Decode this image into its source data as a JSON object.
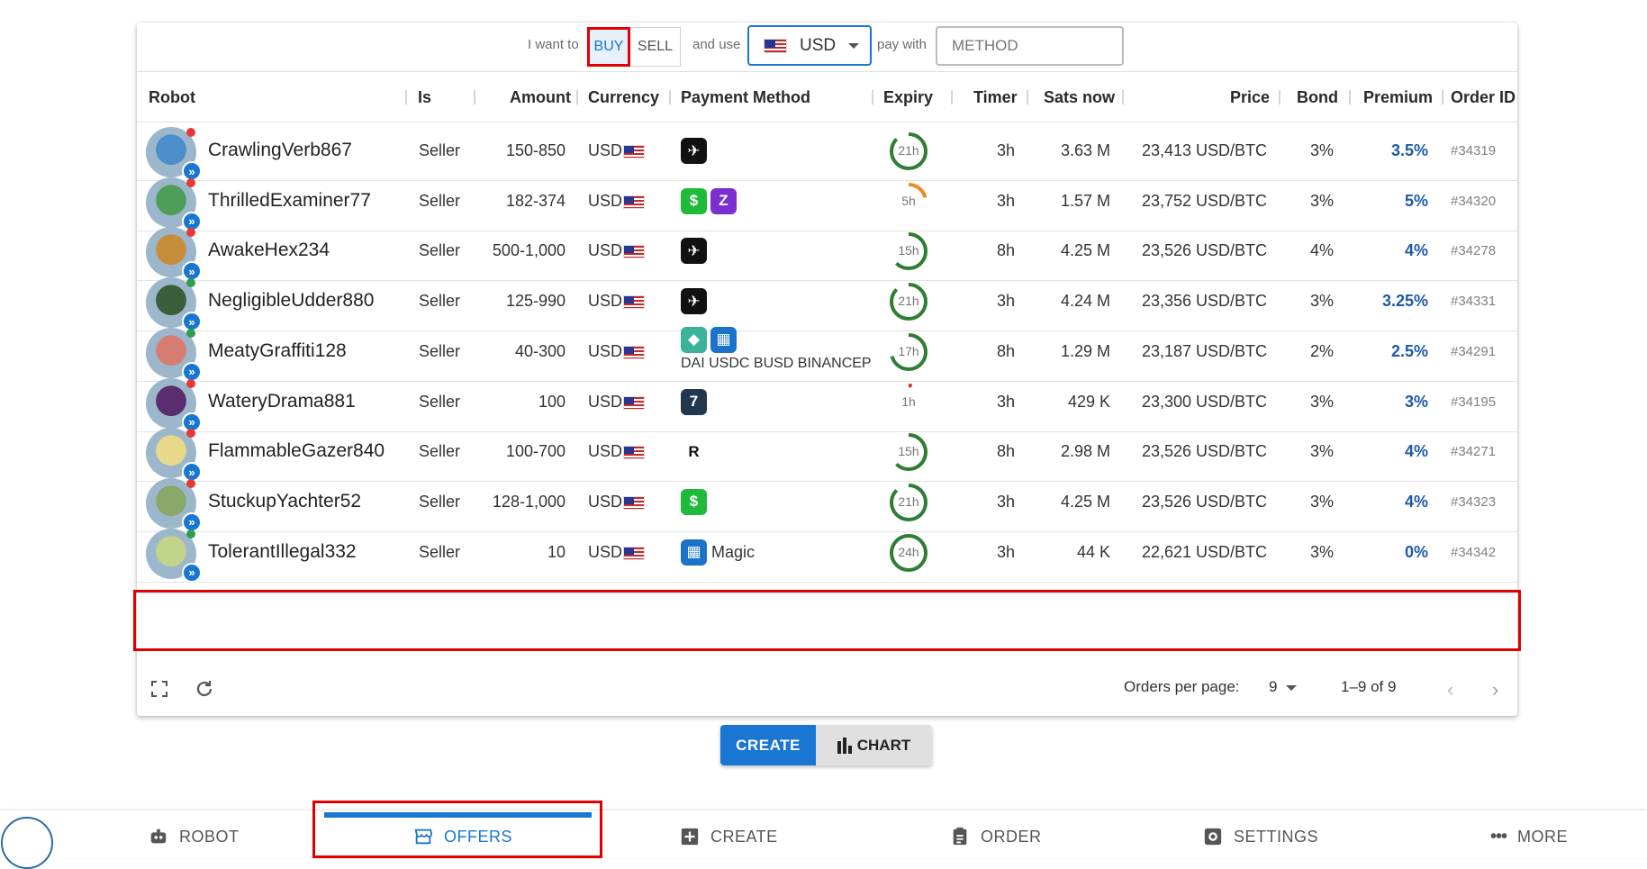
{
  "filter": {
    "i_want_to": "I want to",
    "buy": "BUY",
    "sell": "SELL",
    "and_use": "and use",
    "currency": "USD",
    "pay_with": "pay with",
    "method_placeholder": "METHOD"
  },
  "columns": [
    "Robot",
    "Is",
    "Amount",
    "Currency",
    "Payment Method",
    "Expiry",
    "Timer",
    "Sats now",
    "Price",
    "Bond",
    "Premium",
    "Order ID"
  ],
  "rows": [
    {
      "robot": "CrawlingVerb867",
      "is": "Seller",
      "amount": "150-850",
      "currency": "USD",
      "expiry": "21h",
      "expiry_fraction": 0.875,
      "timer": "3h",
      "sats": "3.63 M",
      "price": "23,413 USD/BTC",
      "bond": "3%",
      "premium": "3.5%",
      "order_id": "#34319",
      "status": "red"
    },
    {
      "robot": "ThrilledExaminer77",
      "is": "Seller",
      "amount": "182-374",
      "currency": "USD",
      "expiry": "5h",
      "expiry_fraction": 0.21,
      "timer": "3h",
      "sats": "1.57 M",
      "price": "23,752 USD/BTC",
      "bond": "3%",
      "premium": "5%",
      "order_id": "#34320",
      "status": "red"
    },
    {
      "robot": "AwakeHex234",
      "is": "Seller",
      "amount": "500-1,000",
      "currency": "USD",
      "expiry": "15h",
      "expiry_fraction": 0.625,
      "timer": "8h",
      "sats": "4.25 M",
      "price": "23,526 USD/BTC",
      "bond": "4%",
      "premium": "4%",
      "order_id": "#34278",
      "status": "red"
    },
    {
      "robot": "NegligibleUdder880",
      "is": "Seller",
      "amount": "125-990",
      "currency": "USD",
      "expiry": "21h",
      "expiry_fraction": 0.875,
      "timer": "3h",
      "sats": "4.24 M",
      "price": "23,356 USD/BTC",
      "bond": "3%",
      "premium": "3.25%",
      "order_id": "#34331",
      "status": "green"
    },
    {
      "robot": "MeatyGraffiti128",
      "is": "Seller",
      "amount": "40-300",
      "currency": "USD",
      "expiry": "17h",
      "expiry_fraction": 0.71,
      "timer": "8h",
      "sats": "1.29 M",
      "price": "23,187 USD/BTC",
      "bond": "2%",
      "premium": "2.5%",
      "order_id": "#34291",
      "status": "green",
      "method_text": "DAI USDC BUSD BINANCEP"
    },
    {
      "robot": "WateryDrama881",
      "is": "Seller",
      "amount": "100",
      "currency": "USD",
      "expiry": "1h",
      "expiry_fraction": 0.03,
      "timer": "3h",
      "sats": "429 K",
      "price": "23,300 USD/BTC",
      "bond": "3%",
      "premium": "3%",
      "order_id": "#34195",
      "status": "red"
    },
    {
      "robot": "FlammableGazer840",
      "is": "Seller",
      "amount": "100-700",
      "currency": "USD",
      "expiry": "15h",
      "expiry_fraction": 0.625,
      "timer": "8h",
      "sats": "2.98 M",
      "price": "23,526 USD/BTC",
      "bond": "3%",
      "premium": "4%",
      "order_id": "#34271",
      "status": "red"
    },
    {
      "robot": "StuckupYachter52",
      "is": "Seller",
      "amount": "128-1,000",
      "currency": "USD",
      "expiry": "21h",
      "expiry_fraction": 0.875,
      "timer": "3h",
      "sats": "4.25 M",
      "price": "23,526 USD/BTC",
      "bond": "3%",
      "premium": "4%",
      "order_id": "#34323",
      "status": "red"
    },
    {
      "robot": "TolerantIllegal332",
      "is": "Seller",
      "amount": "10",
      "currency": "USD",
      "expiry": "24h",
      "expiry_fraction": 1.0,
      "timer": "3h",
      "sats": "44 K",
      "price": "22,621 USD/BTC",
      "bond": "3%",
      "premium": "0%",
      "order_id": "#34342",
      "status": "green",
      "method_text": "Magic"
    }
  ],
  "pagination": {
    "per_page_label": "Orders per page:",
    "per_page": "9",
    "range": "1–9 of 9"
  },
  "actions": {
    "create": "CREATE",
    "chart": "CHART"
  },
  "nav": {
    "robot": "ROBOT",
    "offers": "OFFERS",
    "create": "CREATE",
    "order": "ORDER",
    "settings": "SETTINGS",
    "more": "MORE"
  },
  "colors": {
    "accent": "#1976d2",
    "highlight": "#e00000",
    "premium": "#1e5aa8"
  }
}
